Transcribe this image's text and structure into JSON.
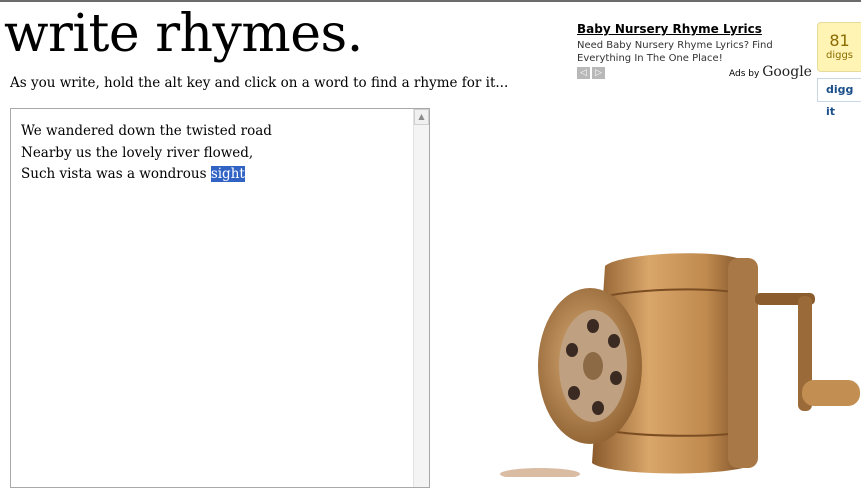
{
  "header": {
    "title": "write rhymes.",
    "instructions": "As you write, hold the alt key and click on a word to find a rhyme for it..."
  },
  "editor": {
    "lines": [
      {
        "before": "We wandered down the twisted road",
        "selected": ""
      },
      {
        "before": "Nearby us the lovely river flowed,",
        "selected": ""
      },
      {
        "before": "Such vista was a wondrous ",
        "selected": "sight"
      }
    ],
    "scroll_up_icon": "▲"
  },
  "ad": {
    "title": "Baby Nursery Rhyme Lyrics",
    "description": "Need Baby Nursery Rhyme Lyrics? Find Everything In The One Place!",
    "prev_icon": "◁",
    "next_icon": "▷",
    "ads_by": "Ads by",
    "google": "Google"
  },
  "digg": {
    "count": "81",
    "label": "diggs",
    "button": "digg it"
  },
  "colors": {
    "selection": "#3163c5",
    "digg_bg": "#fff4b4"
  },
  "image": {
    "subject": "pencil-sharpener"
  }
}
